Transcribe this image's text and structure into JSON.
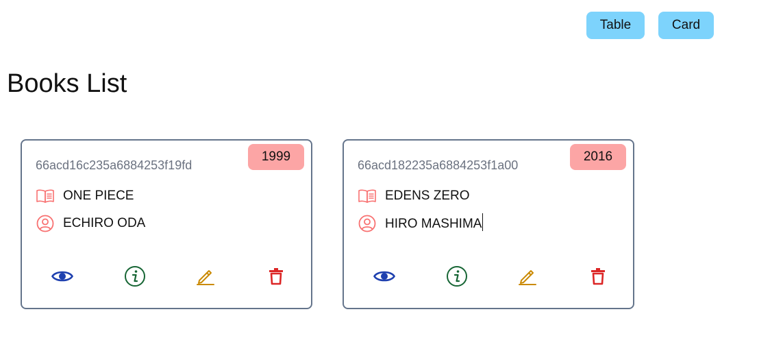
{
  "toolbar": {
    "table_label": "Table",
    "card_label": "Card"
  },
  "page": {
    "title": "Books List"
  },
  "colors": {
    "button_bg": "#7dd3fc",
    "badge_bg": "#fca5a5",
    "icon_pink": "#f87171",
    "view_icon": "#1e40af",
    "info_icon": "#166534",
    "edit_icon": "#ca8a04",
    "delete_icon": "#dc2626",
    "card_border": "#64748b"
  },
  "books": [
    {
      "id": "66acd16c235a6884253f19fd",
      "year": "1999",
      "title": "ONE PIECE",
      "author": "ECHIRO ODA"
    },
    {
      "id": "66acd182235a6884253f1a00",
      "year": "2016",
      "title": "EDENS ZERO",
      "author": "HIRO MASHIMA"
    }
  ],
  "icons": {
    "title": "book-open-icon",
    "author": "user-circle-icon",
    "view": "eye-icon",
    "info": "info-circle-icon",
    "edit": "pencil-icon",
    "delete": "trash-icon"
  }
}
